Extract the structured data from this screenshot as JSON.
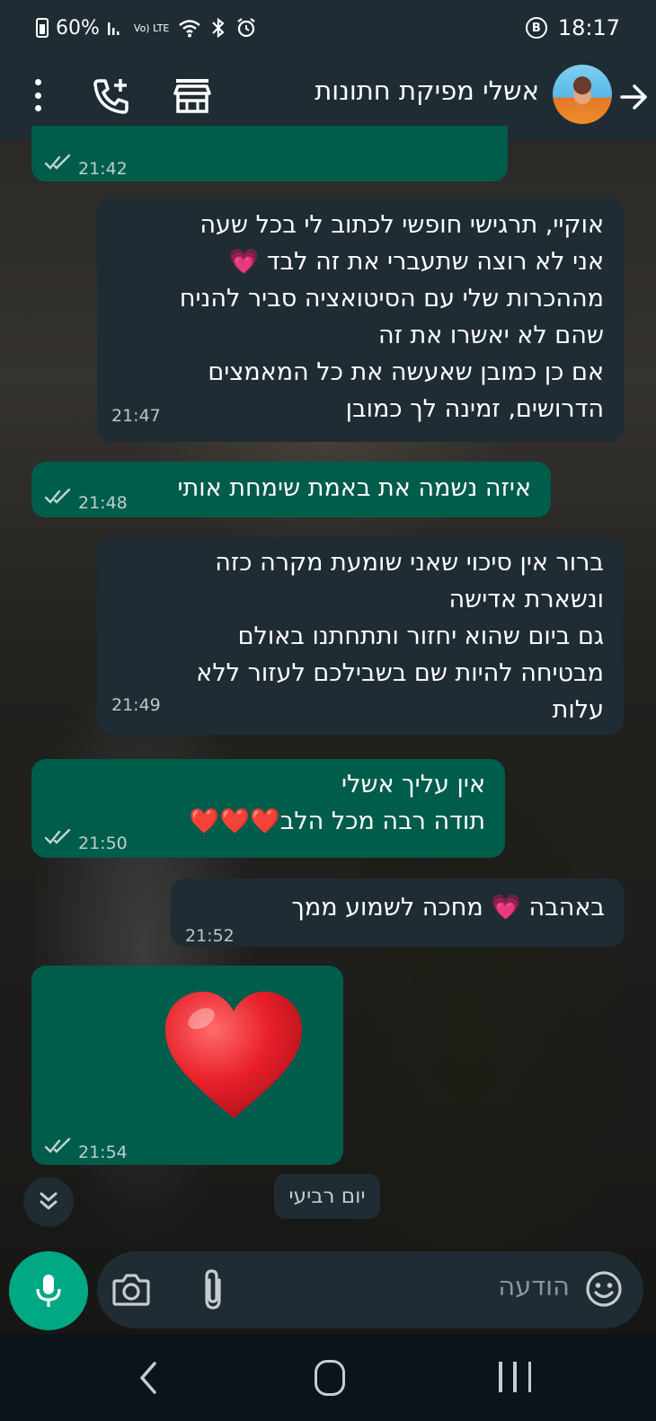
{
  "statusbar": {
    "battery": "60%",
    "network": "Vo) LTE",
    "time": "18:17",
    "icons": [
      "signal-icon",
      "volte-icon",
      "wifi-icon",
      "bluetooth-icon",
      "alarm-icon",
      "b-circle-icon"
    ]
  },
  "header": {
    "contact_name": "אשלי מפיקת חתונות",
    "icons": [
      "back-arrow-icon",
      "avatar",
      "store-icon",
      "add-call-icon",
      "more-vert-icon"
    ]
  },
  "messages": [
    {
      "id": "m0",
      "direction": "out",
      "lines": [],
      "time": "21:42",
      "status": "read"
    },
    {
      "id": "m1",
      "direction": "in",
      "lines": [
        "אוקיי, תרגישי חופשי לכתוב לי בכל שעה",
        "אני לא רוצה שתעברי את זה לבד 💗",
        "מההכרות שלי עם הסיטואציה סביר להניח",
        "שהם לא יאשרו את זה",
        "אם כן כמובן שאעשה את כל המאמצים",
        "הדרושים, זמינה לך כמובן"
      ],
      "time": "21:47"
    },
    {
      "id": "m2",
      "direction": "out",
      "lines": [
        "איזה נשמה את באמת שימחת אותי"
      ],
      "time": "21:48",
      "status": "read"
    },
    {
      "id": "m3",
      "direction": "in",
      "lines": [
        "ברור אין סיכוי שאני שומעת מקרה כזה",
        "ונשארת אדישה",
        "גם ביום שהוא יחזור ותתחתנו באולם",
        "מבטיחה להיות שם בשבילכם לעזור ללא",
        "עלות"
      ],
      "time": "21:49"
    },
    {
      "id": "m4",
      "direction": "out",
      "lines": [
        "אין עליך אשלי",
        "תודה רבה מכל הלב❤️❤️❤️"
      ],
      "time": "21:50",
      "status": "read"
    },
    {
      "id": "m5",
      "direction": "in",
      "lines": [
        "באהבה 💗 מחכה לשמוע ממך"
      ],
      "time": "21:52"
    },
    {
      "id": "m6",
      "direction": "out",
      "lines": [
        "❤️"
      ],
      "time": "21:54",
      "status": "read",
      "big_emoji": true
    }
  ],
  "day_separator": "יום רביעי",
  "composer": {
    "placeholder": "הודעה",
    "icons": [
      "emoji-icon",
      "attach-icon",
      "camera-icon",
      "mic-icon"
    ]
  },
  "navbar": {
    "icons": [
      "nav-back-icon",
      "nav-home-icon",
      "nav-recents-icon"
    ]
  },
  "colors": {
    "incoming_bubble": "#1f2c34",
    "outgoing_bubble": "#005c4b",
    "accent": "#00a884",
    "header": "#1f2c34"
  }
}
